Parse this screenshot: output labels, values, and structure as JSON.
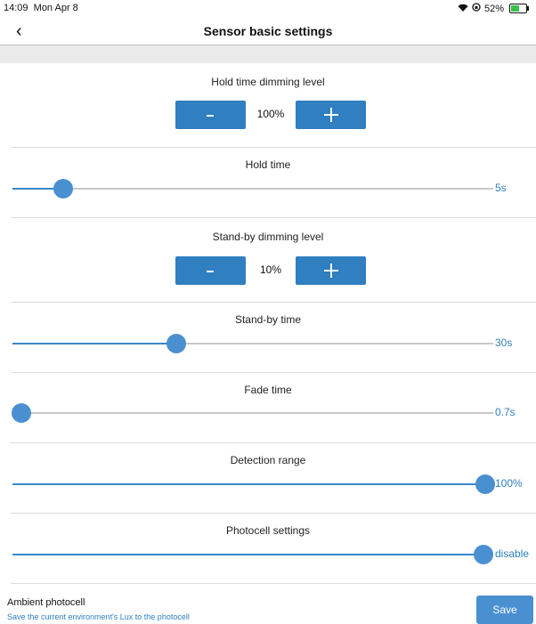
{
  "status": {
    "time": "14:09",
    "date": "Mon Apr 8",
    "battery": "52%"
  },
  "nav": {
    "title": "Sensor basic settings"
  },
  "hold_dim": {
    "label": "Hold time dimming level",
    "value": "100%"
  },
  "hold_time": {
    "label": "Hold time",
    "value": "5s",
    "position": 0.106
  },
  "standby_dim": {
    "label": "Stand-by dimming level",
    "value": "10%"
  },
  "standby_time": {
    "label": "Stand-by time",
    "value": "30s",
    "position": 0.341
  },
  "fade_time": {
    "label": "Fade time",
    "value": "0.7s",
    "position": 0.019
  },
  "detection": {
    "label": "Detection range",
    "value": "100%",
    "position": 0.984
  },
  "photocell": {
    "label": "Photocell settings",
    "value": "disable",
    "position": 0.98
  },
  "footer": {
    "title": "Ambient photocell",
    "subtitle": "Save the current environment's Lux to the photocell",
    "save_label": "Save"
  },
  "colors": {
    "accent": "#2f7fc1",
    "thumb": "#4a90d0"
  }
}
